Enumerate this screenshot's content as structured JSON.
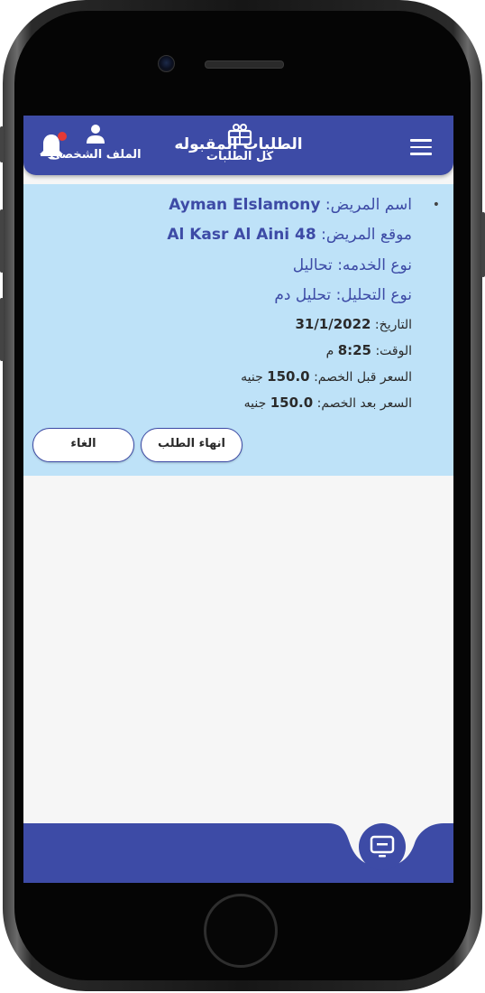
{
  "appbar": {
    "title": "الطلبات المقبوله"
  },
  "request": {
    "patient_name_label": "اسم المريض: ",
    "patient_name": "Ayman Elslamony",
    "patient_location_label": "موقع المريض: ",
    "patient_location": "Al Kasr Al Aini 48",
    "service_type": "نوع الخدمه: تحاليل",
    "analysis_type": "نوع التحليل: تحليل دم",
    "date_label": "التاريخ: ",
    "date": "31/1/2022",
    "time_label": "الوقت: ",
    "time": "8:25",
    "time_suffix": " م",
    "price_before_label": "السعر قبل الخصم: ",
    "price_before": "150.0",
    "price_after_label": "السعر بعد الخصم: ",
    "price_after": "150.0",
    "currency": " جنيه",
    "finish_button": "انهاء الطلب",
    "cancel_button": "الغاء"
  },
  "bottom_nav": {
    "profile_label": "الملف الشخصى",
    "all_requests_label": "كل الطلبات"
  },
  "colors": {
    "primary": "#3d4ba6",
    "card_background": "#bee2f8",
    "notification_dot": "#e53935"
  }
}
